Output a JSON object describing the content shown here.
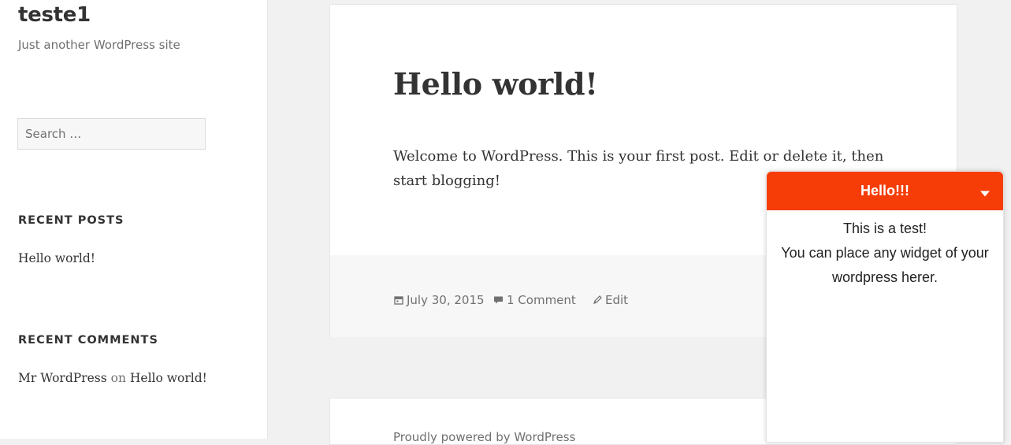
{
  "site": {
    "title": "teste1",
    "description": "Just another WordPress site"
  },
  "search": {
    "placeholder": "Search …"
  },
  "widgets": {
    "recent_posts": {
      "title": "RECENT POSTS",
      "items": [
        "Hello world!"
      ]
    },
    "recent_comments": {
      "title": "RECENT COMMENTS",
      "items": [
        {
          "author": "Mr WordPress",
          "on": "on",
          "post": "Hello world!"
        }
      ]
    }
  },
  "post": {
    "title": "Hello world!",
    "content": "Welcome to WordPress. This is your first post. Edit or delete it, then start blogging!",
    "meta": {
      "date": "July 30, 2015",
      "comments": "1 Comment",
      "edit": "Edit"
    }
  },
  "footer": {
    "credit": "Proudly powered by WordPress"
  },
  "floating_widget": {
    "title": "Hello!!!",
    "lines": [
      "This is a test!",
      "You can place any widget of your wordpress herer."
    ],
    "accent_color": "#f63d07"
  },
  "icons": {
    "date": "calendar-icon",
    "comments": "comment-icon",
    "edit": "pencil-icon",
    "toggle": "caret-down-icon"
  }
}
